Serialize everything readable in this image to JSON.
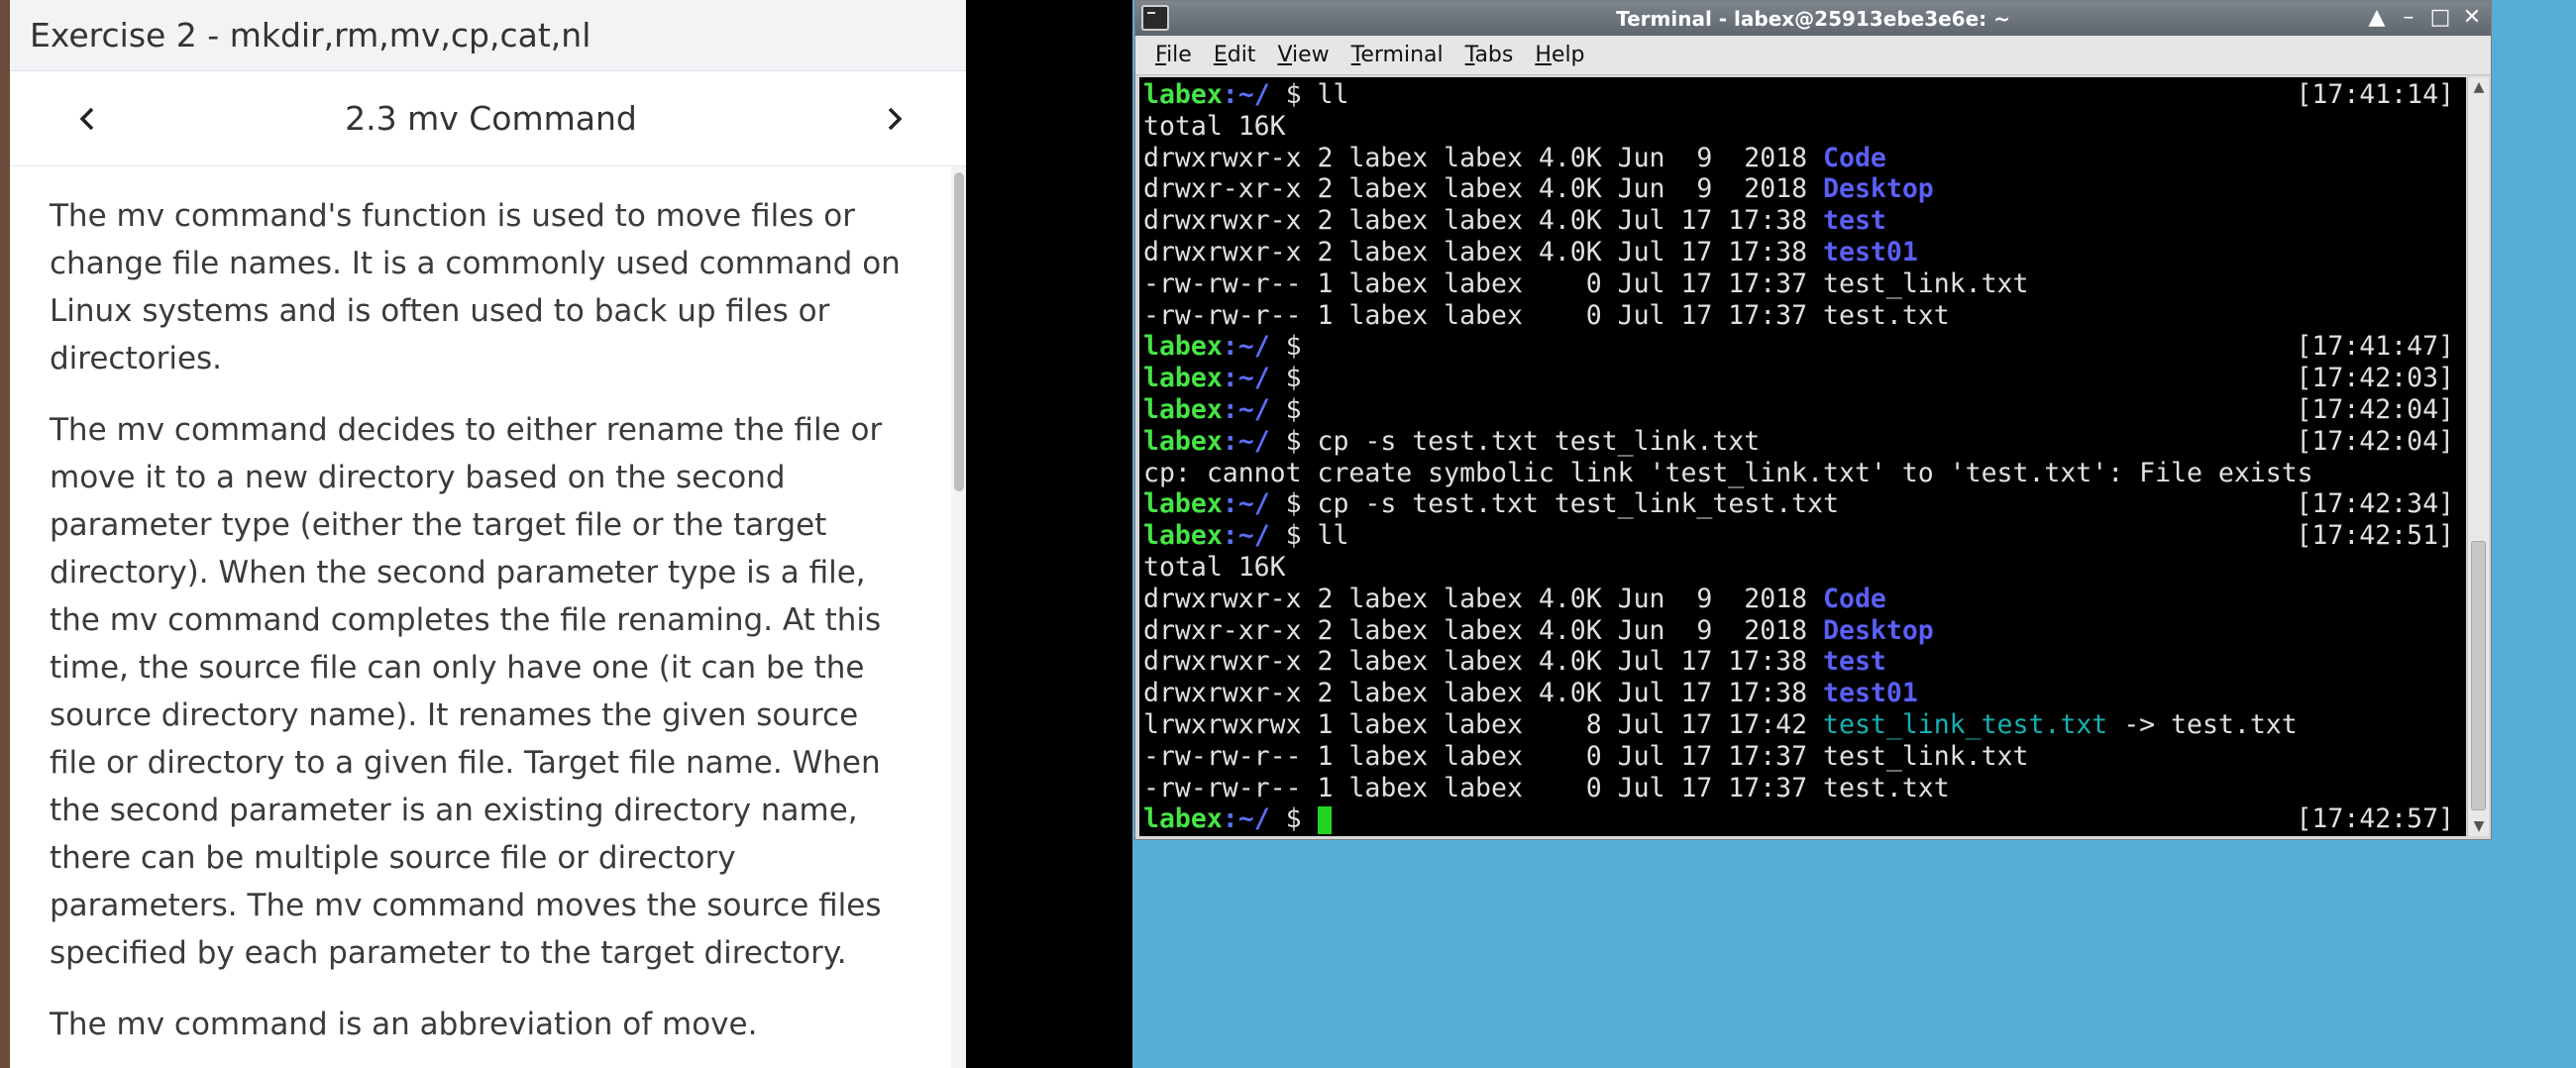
{
  "panel": {
    "header_title": "Exercise 2 - mkdir,rm,mv,cp,cat,nl",
    "section_title": "2.3 mv Command",
    "prev_icon": "chevron-left-icon",
    "next_icon": "chevron-right-icon",
    "paragraphs": [
      "The mv command's function is used to move files or change file names. It is a commonly used command on Linux systems and is often used to back up files or directories.",
      "The mv command decides to either rename the file or move it to a new directory based on the second parameter type (either the target file or the target directory). When the second parameter type is a file, the mv command completes the file renaming. At this time, the source file can only have one (it can be the source directory name). It renames the given source file or directory to a given file. Target file name. When the second parameter is an existing directory name, there can be multiple source file or directory parameters. The mv command moves the source files specified by each parameter to the target directory.",
      "The mv command is an abbreviation of move."
    ]
  },
  "terminal": {
    "title": "Terminal - labex@25913ebe3e6e: ~",
    "wm_buttons": [
      "▲",
      "–",
      "□",
      "✕"
    ],
    "menus": [
      {
        "u": "F",
        "rest": "ile"
      },
      {
        "u": "E",
        "rest": "dit"
      },
      {
        "u": "V",
        "rest": "iew"
      },
      {
        "u": "T",
        "rest": "erminal"
      },
      {
        "u": "T",
        "rest": "abs"
      },
      {
        "u": "H",
        "rest": "elp"
      }
    ],
    "prompt_user": "labex",
    "prompt_path": ":~/",
    "prompt_symbol": " $ ",
    "lines": [
      {
        "kind": "prompt",
        "cmd": "ll",
        "ts": "[17:41:14]"
      },
      {
        "kind": "text",
        "text": "total 16K"
      },
      {
        "kind": "ls",
        "perm": "drwxrwxr-x 2 labex labex 4.0K Jun  9  2018 ",
        "name": "Code",
        "style": "dir"
      },
      {
        "kind": "ls",
        "perm": "drwxr-xr-x 2 labex labex 4.0K Jun  9  2018 ",
        "name": "Desktop",
        "style": "dir"
      },
      {
        "kind": "ls",
        "perm": "drwxrwxr-x 2 labex labex 4.0K Jul 17 17:38 ",
        "name": "test",
        "style": "dir"
      },
      {
        "kind": "ls",
        "perm": "drwxrwxr-x 2 labex labex 4.0K Jul 17 17:38 ",
        "name": "test01",
        "style": "dir"
      },
      {
        "kind": "ls",
        "perm": "-rw-rw-r-- 1 labex labex    0 Jul 17 17:37 ",
        "name": "test_link.txt",
        "style": "file"
      },
      {
        "kind": "ls",
        "perm": "-rw-rw-r-- 1 labex labex    0 Jul 17 17:37 ",
        "name": "test.txt",
        "style": "file"
      },
      {
        "kind": "prompt",
        "cmd": "",
        "ts": "[17:41:47]"
      },
      {
        "kind": "prompt",
        "cmd": "",
        "ts": "[17:42:03]"
      },
      {
        "kind": "prompt",
        "cmd": "",
        "ts": "[17:42:04]"
      },
      {
        "kind": "prompt",
        "cmd": "cp -s test.txt test_link.txt",
        "ts": "[17:42:04]"
      },
      {
        "kind": "text",
        "text": "cp: cannot create symbolic link 'test_link.txt' to 'test.txt': File exists"
      },
      {
        "kind": "prompt",
        "cmd": "cp -s test.txt test_link_test.txt",
        "ts": "[17:42:34]"
      },
      {
        "kind": "prompt",
        "cmd": "ll",
        "ts": "[17:42:51]"
      },
      {
        "kind": "text",
        "text": "total 16K"
      },
      {
        "kind": "ls",
        "perm": "drwxrwxr-x 2 labex labex 4.0K Jun  9  2018 ",
        "name": "Code",
        "style": "dir"
      },
      {
        "kind": "ls",
        "perm": "drwxr-xr-x 2 labex labex 4.0K Jun  9  2018 ",
        "name": "Desktop",
        "style": "dir"
      },
      {
        "kind": "ls",
        "perm": "drwxrwxr-x 2 labex labex 4.0K Jul 17 17:38 ",
        "name": "test",
        "style": "dir"
      },
      {
        "kind": "ls",
        "perm": "drwxrwxr-x 2 labex labex 4.0K Jul 17 17:38 ",
        "name": "test01",
        "style": "dir"
      },
      {
        "kind": "ls",
        "perm": "lrwxrwxrwx 1 labex labex    8 Jul 17 17:42 ",
        "name": "test_link_test.txt",
        "style": "link",
        "target": " -> test.txt"
      },
      {
        "kind": "ls",
        "perm": "-rw-rw-r-- 1 labex labex    0 Jul 17 17:37 ",
        "name": "test_link.txt",
        "style": "file"
      },
      {
        "kind": "ls",
        "perm": "-rw-rw-r-- 1 labex labex    0 Jul 17 17:37 ",
        "name": "test.txt",
        "style": "file"
      },
      {
        "kind": "prompt",
        "cmd": "",
        "ts": "[17:42:57]",
        "cursor": true
      }
    ]
  }
}
